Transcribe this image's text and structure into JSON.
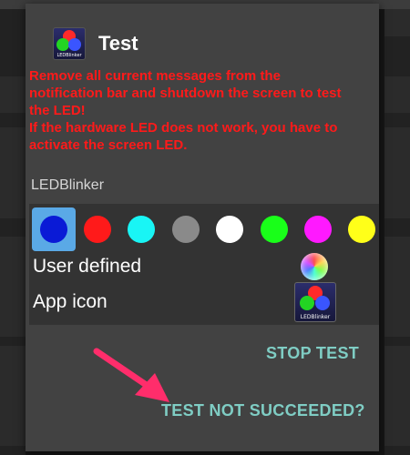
{
  "dialog": {
    "title": "Test",
    "message_lines": [
      "Remove all current messages from the",
      "notification bar and shutdown the screen to test",
      "the LED!",
      "If the hardware LED does not work, you have to",
      "activate the screen LED."
    ],
    "app_logo_text": "LEDBlinker",
    "section_label": "LEDBlinker",
    "colors": [
      {
        "name": "blue",
        "hex": "#0a1ad6",
        "selected": true
      },
      {
        "name": "red",
        "hex": "#ff1a1a",
        "selected": false
      },
      {
        "name": "cyan",
        "hex": "#19f5f5",
        "selected": false
      },
      {
        "name": "gray",
        "hex": "#8a8a8a",
        "selected": false
      },
      {
        "name": "white",
        "hex": "#ffffff",
        "selected": false
      },
      {
        "name": "green",
        "hex": "#19ff19",
        "selected": false
      },
      {
        "name": "magenta",
        "hex": "#ff19ff",
        "selected": false
      },
      {
        "name": "yellow",
        "hex": "#ffff19",
        "selected": false
      }
    ],
    "user_defined_label": "User defined",
    "user_defined_icon": "rainbow-color-picker-icon",
    "app_icon_label": "App icon",
    "app_icon": "ledblinker-app-icon",
    "stop_test_label": "STOP TEST",
    "not_succeeded_label": "TEST NOT SUCCEEDED?"
  },
  "colors": {
    "dialog_bg": "#424242",
    "message_red": "#ff1a1a",
    "accent_teal": "#7fcdc4",
    "selected_highlight": "#5aa9e6",
    "annotation_arrow": "#ff2d6b"
  },
  "annotation": {
    "icon": "pointer-arrow-icon"
  }
}
